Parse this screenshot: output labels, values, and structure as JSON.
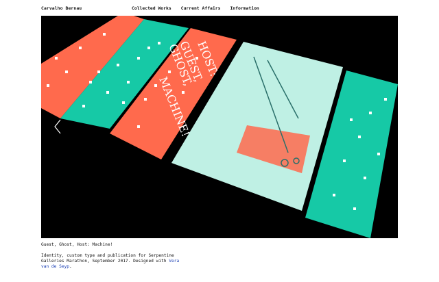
{
  "header": {
    "site_title": "Carvalho Bernau",
    "nav": [
      "Collected Works",
      "Current Affairs",
      "Information"
    ]
  },
  "colors": {
    "coral": "#ff6a4d",
    "teal": "#16c9a6",
    "mint": "#bff0e4",
    "background": "#000000",
    "link": "#1a3fb4"
  },
  "slideshow": {
    "prev_icon": "chevron-left-icon",
    "cover_text": [
      "GUEST,",
      "GHOST,",
      "HOST:",
      "MACHINE!"
    ]
  },
  "caption": {
    "title": "Guest, Ghost, Host: Machine!",
    "description": "Identity, custom type and publication for Serpentine Galleries Marathon, September 2017. Designed with ",
    "link_text": "Vera van de Seyp",
    "tail": "."
  }
}
